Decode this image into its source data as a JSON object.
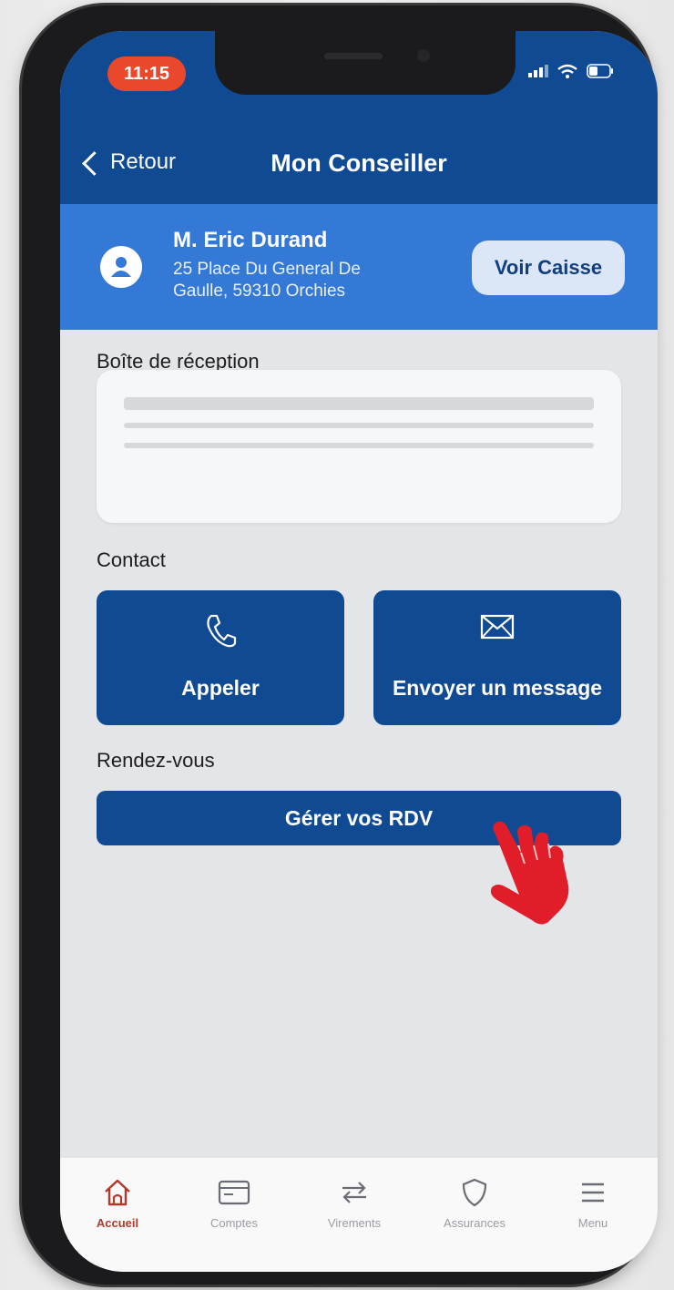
{
  "status_bar": {
    "time": "11:15"
  },
  "nav": {
    "back_label": "Retour",
    "title": "Mon Conseiller"
  },
  "advisor": {
    "name": "M. Eric Durand",
    "address_line1": "25 Place Du General De",
    "address_line2": "Gaulle, 59310 Orchies",
    "voir_caisse_label": "Voir Caisse"
  },
  "inbox": {
    "label": "Boîte de réception"
  },
  "contact": {
    "label": "Contact",
    "call_label": "Appeler",
    "message_label": "Envoyer un message"
  },
  "rdv": {
    "label": "Rendez-vous",
    "button_label": "Gérer vos RDV"
  },
  "tabbar": {
    "items": [
      {
        "label": "Accueil",
        "icon": "home-icon",
        "active": true
      },
      {
        "label": "Comptes",
        "icon": "card-icon",
        "active": false
      },
      {
        "label": "Virements",
        "icon": "transfer-icon",
        "active": false
      },
      {
        "label": "Assurances",
        "icon": "shield-icon",
        "active": false
      },
      {
        "label": "Menu",
        "icon": "menu-icon",
        "active": false
      }
    ]
  },
  "colors": {
    "primary": "#0f4a93",
    "advisor_band": "#3579d6",
    "active_tab": "#b3392b",
    "time_pill": "#e9482d",
    "hand_cursor": "#e11d2a"
  }
}
